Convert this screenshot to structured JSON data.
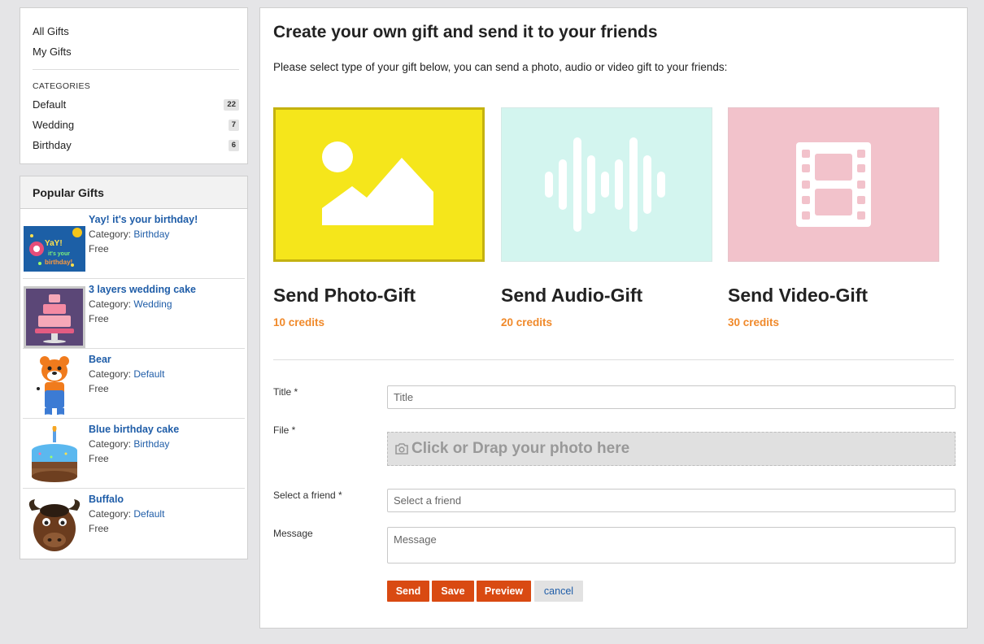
{
  "nav": {
    "all_gifts": "All Gifts",
    "my_gifts": "My Gifts",
    "categories_heading": "CATEGORIES",
    "categories": [
      {
        "label": "Default",
        "count": "22"
      },
      {
        "label": "Wedding",
        "count": "7"
      },
      {
        "label": "Birthday",
        "count": "6"
      }
    ]
  },
  "popular": {
    "heading": "Popular Gifts",
    "category_prefix": "Category:",
    "items": [
      {
        "title": "Yay! it's your birthday!",
        "category": "Birthday",
        "price": "Free",
        "thumb_icon": "birthday-card-icon"
      },
      {
        "title": "3 layers wedding cake",
        "category": "Wedding",
        "price": "Free",
        "thumb_icon": "wedding-cake-icon"
      },
      {
        "title": "Bear",
        "category": "Default",
        "price": "Free",
        "thumb_icon": "bear-icon"
      },
      {
        "title": "Blue birthday cake",
        "category": "Birthday",
        "price": "Free",
        "thumb_icon": "birthday-cake-icon"
      },
      {
        "title": "Buffalo",
        "category": "Default",
        "price": "Free",
        "thumb_icon": "buffalo-icon"
      }
    ]
  },
  "main": {
    "title": "Create your own gift and send it to your friends",
    "subtitle": "Please select type of your gift below, you can send a photo, audio or video gift to your friends:",
    "gift_types": [
      {
        "name": "Send Photo-Gift",
        "credits": "10 credits",
        "color": "#f5e61b",
        "icon": "image-icon",
        "selected": true
      },
      {
        "name": "Send Audio-Gift",
        "credits": "20 credits",
        "color": "#d3f5ef",
        "icon": "audio-wave-icon",
        "selected": false
      },
      {
        "name": "Send Video-Gift",
        "credits": "30 credits",
        "color": "#f2c2cb",
        "icon": "film-strip-icon",
        "selected": false
      }
    ]
  },
  "form": {
    "title_label": "Title *",
    "title_placeholder": "Title",
    "file_label": "File *",
    "file_drop_text": "Click or Drap your photo here",
    "friend_label": "Select a friend *",
    "friend_placeholder": "Select a friend",
    "message_label": "Message",
    "message_placeholder": "Message",
    "buttons": {
      "send": "Send",
      "save": "Save",
      "preview": "Preview",
      "cancel": "cancel"
    }
  },
  "colors": {
    "accent": "#d94a12",
    "link": "#1f5da8",
    "credits": "#f0892a"
  }
}
